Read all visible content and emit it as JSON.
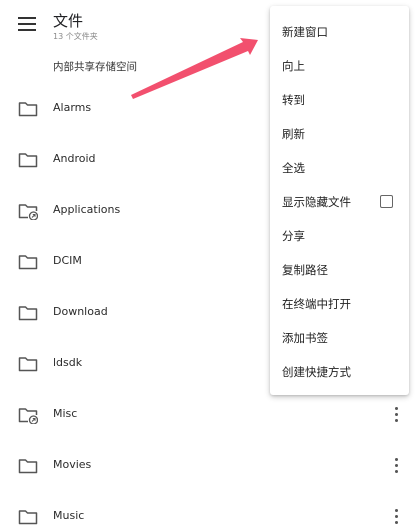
{
  "header": {
    "title": "文件",
    "subtitle": "13 个文件夹",
    "menu_icon": "hamburger-menu-icon"
  },
  "breadcrumb": "内部共享存储空间",
  "files": [
    {
      "name": "Alarms",
      "icon": "folder-icon"
    },
    {
      "name": "Android",
      "icon": "folder-icon"
    },
    {
      "name": "Applications",
      "icon": "folder-shortcut-icon"
    },
    {
      "name": "DCIM",
      "icon": "folder-icon"
    },
    {
      "name": "Download",
      "icon": "folder-icon"
    },
    {
      "name": "ldsdk",
      "icon": "folder-icon"
    },
    {
      "name": "Misc",
      "icon": "folder-shortcut-icon"
    },
    {
      "name": "Movies",
      "icon": "folder-icon"
    },
    {
      "name": "Music",
      "icon": "folder-icon"
    }
  ],
  "context_menu": {
    "items": [
      {
        "label": "新建窗口"
      },
      {
        "label": "向上"
      },
      {
        "label": "转到"
      },
      {
        "label": "刷新"
      },
      {
        "label": "全选"
      },
      {
        "label": "显示隐藏文件",
        "checkbox": false
      },
      {
        "label": "分享"
      },
      {
        "label": "复制路径"
      },
      {
        "label": "在终端中打开"
      },
      {
        "label": "添加书签"
      },
      {
        "label": "创建快捷方式"
      }
    ]
  },
  "colors": {
    "annotation_arrow": "#f2506e",
    "icon": "#555555"
  }
}
